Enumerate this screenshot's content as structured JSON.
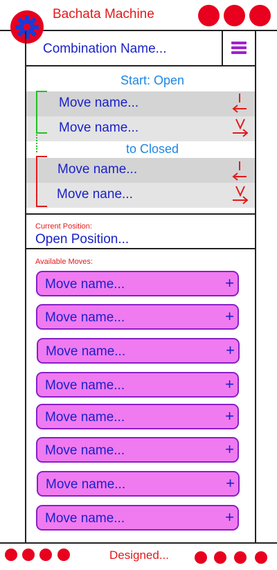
{
  "header": {
    "title": "Bachata Machine",
    "logo_icon": "gear-icon",
    "accent_color": "#e8001e"
  },
  "combination": {
    "name_placeholder": "Combination Name...",
    "menu_icon": "menu-icon"
  },
  "combo_panel": {
    "start_label": "Start: Open",
    "end_label": "to Closed",
    "group_open": [
      {
        "label": "Move name...",
        "arrow": "lead-left-arrow-icon",
        "mark": "I"
      },
      {
        "label": "Move name...",
        "arrow": "right-arrow-icon",
        "mark": "V"
      }
    ],
    "group_closed": [
      {
        "label": "Move name...",
        "arrow": "lead-left-arrow-icon",
        "mark": "I"
      },
      {
        "label": "Move nane...",
        "arrow": "right-arrow-icon",
        "mark": "V"
      }
    ]
  },
  "current": {
    "label": "Current Position:",
    "value": "Open Position..."
  },
  "available": {
    "label": "Available Moves:",
    "moves": [
      {
        "label": "Move name...",
        "add": "+"
      },
      {
        "label": "Move name...",
        "add": "+"
      },
      {
        "label": "Move name...",
        "add": "+"
      },
      {
        "label": "Move name...",
        "add": "+"
      },
      {
        "label": "Move name...",
        "add": "+"
      },
      {
        "label": "Move name...",
        "add": "+"
      },
      {
        "label": "Move name...",
        "add": "+"
      },
      {
        "label": "Move name...",
        "add": "+"
      }
    ]
  },
  "footer": {
    "text": "Designed..."
  }
}
